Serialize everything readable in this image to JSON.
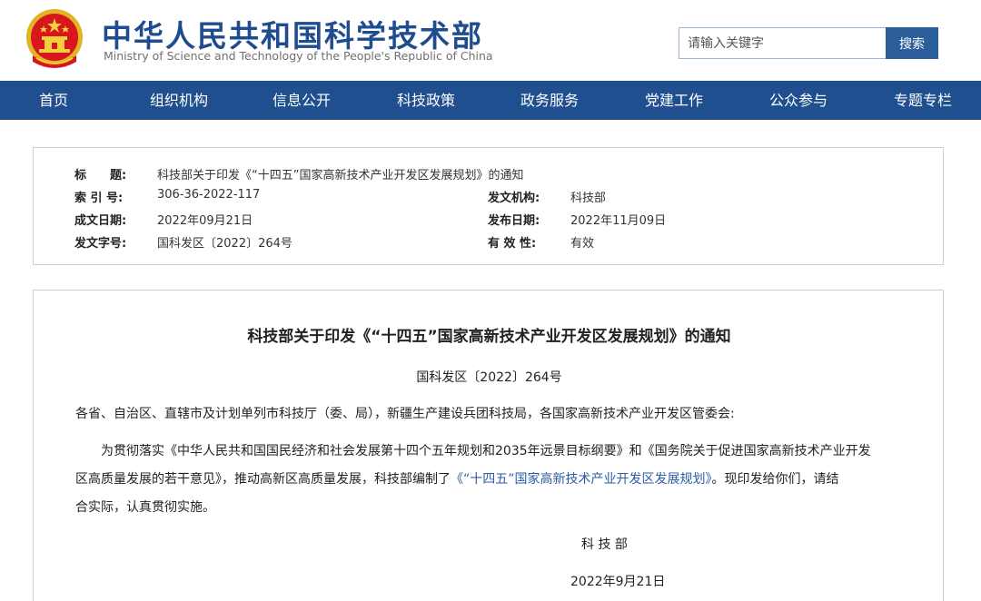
{
  "header": {
    "site_title": "中华人民共和国科学技术部",
    "site_subtitle": "Ministry of Science and Technology of the People's Republic of China",
    "search_placeholder": "请输入关键字",
    "search_button": "搜索",
    "emblem_icon": "national-emblem-icon"
  },
  "nav": {
    "items": [
      {
        "label": "首页"
      },
      {
        "label": "组织机构"
      },
      {
        "label": "信息公开"
      },
      {
        "label": "科技政策"
      },
      {
        "label": "政务服务"
      },
      {
        "label": "党建工作"
      },
      {
        "label": "公众参与"
      },
      {
        "label": "专题专栏"
      }
    ]
  },
  "meta": {
    "title_label": "标　　题:",
    "title_value": "科技部关于印发《“十四五”国家高新技术产业开发区发展规划》的通知",
    "index_label": "索 引 号:",
    "index_value": "306-36-2022-117",
    "issuer_label": "发文机构:",
    "issuer_value": "科技部",
    "created_label": "成文日期:",
    "created_value": "2022年09月21日",
    "published_label": "发布日期:",
    "published_value": "2022年11月09日",
    "docno_label": "发文字号:",
    "docno_value": "国科发区〔2022〕264号",
    "validity_label": "有 效 性:",
    "validity_value": "有效"
  },
  "article": {
    "title": "科技部关于印发《“十四五”国家高新技术产业开发区发展规划》的通知",
    "doc_number": "国科发区〔2022〕264号",
    "addressee": "各省、自治区、直辖市及计划单列市科技厅（委、局），新疆生产建设兵团科技局，各国家高新技术产业开发区管委会:",
    "body_line1": "为贯彻落实《中华人民共和国国民经济和社会发展第十四个五年规划和2035年远景目标纲要》和《国务院关于促进国家高新技术产业开发",
    "body_line2_pre": "区高质量发展的若干意见》，推动高新区高质量发展，科技部编制了",
    "body_line2_link": "《“十四五”国家高新技术产业开发区发展规划》",
    "body_line2_post": "。现印发给你们，请结",
    "body_line3": "合实际，认真贯彻实施。",
    "signature": "科 技 部",
    "date": "2022年9月21日"
  },
  "colors": {
    "brand_blue": "#1f4f8f",
    "title_blue": "#1f4b8f",
    "emblem_red": "#d7171d",
    "emblem_gold": "#f1c40f",
    "link_blue": "#2a5da6"
  }
}
